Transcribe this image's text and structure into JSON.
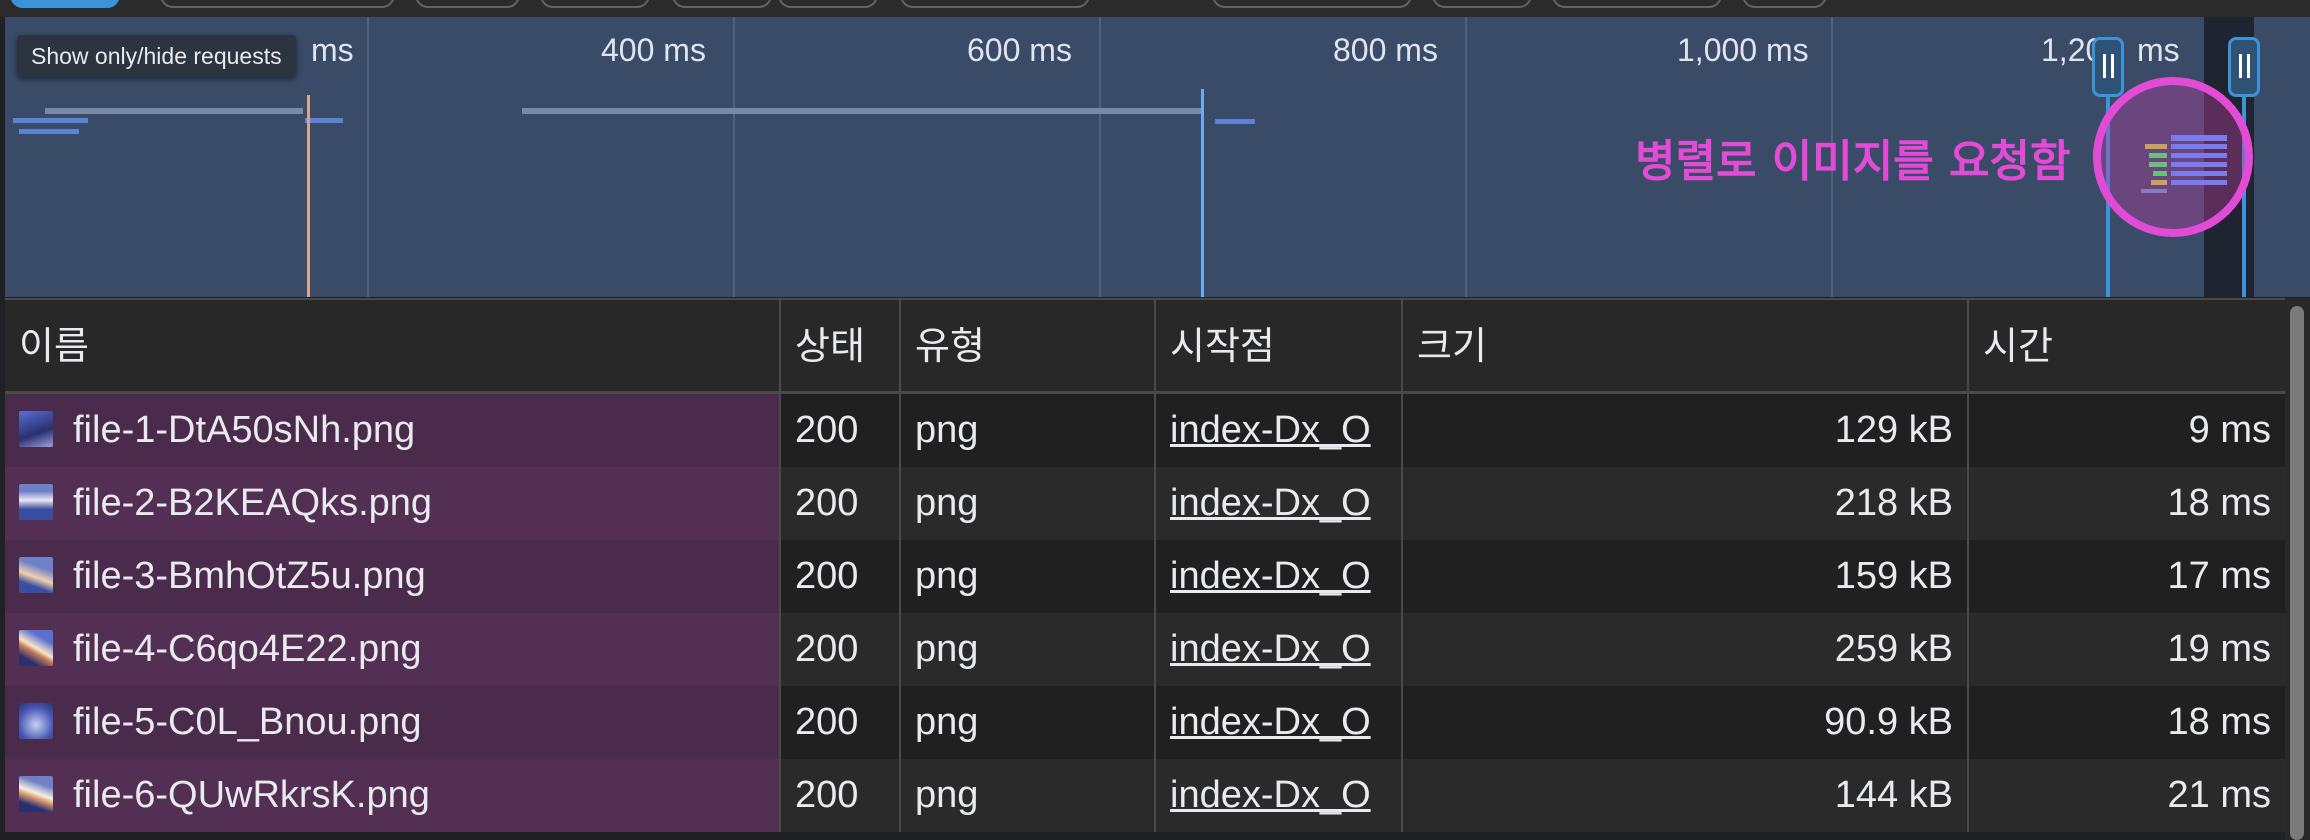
{
  "tooltip": "Show only/hide requests",
  "annotation": "병렬로 이미지를 요청함",
  "overview": {
    "ticks": [
      "ms",
      "400 ms",
      "600 ms",
      "800 ms",
      "1,000 ms",
      "1,20",
      "ms"
    ]
  },
  "columns": [
    "이름",
    "상태",
    "유형",
    "시작점",
    "크기",
    "시간"
  ],
  "rows": [
    {
      "name": "file-1-DtA50sNh.png",
      "status": "200",
      "type": "png",
      "initiator": "index-Dx_O",
      "size": "129 kB",
      "time": "9 ms"
    },
    {
      "name": "file-2-B2KEAQks.png",
      "status": "200",
      "type": "png",
      "initiator": "index-Dx_O",
      "size": "218 kB",
      "time": "18 ms"
    },
    {
      "name": "file-3-BmhOtZ5u.png",
      "status": "200",
      "type": "png",
      "initiator": "index-Dx_O",
      "size": "159 kB",
      "time": "17 ms"
    },
    {
      "name": "file-4-C6qo4E22.png",
      "status": "200",
      "type": "png",
      "initiator": "index-Dx_O",
      "size": "259 kB",
      "time": "19 ms"
    },
    {
      "name": "file-5-C0L_Bnou.png",
      "status": "200",
      "type": "png",
      "initiator": "index-Dx_O",
      "size": "90.9 kB",
      "time": "18 ms"
    },
    {
      "name": "file-6-QUwRkrsK.png",
      "status": "200",
      "type": "png",
      "initiator": "index-Dx_O",
      "size": "144 kB",
      "time": "21 ms"
    }
  ],
  "colors": {
    "annotation": "#e24bd6",
    "accent": "#3d93d8",
    "name_column": "#4a2b4b"
  },
  "icons": [
    "waterfall-icon",
    "image-thumbnail-icon",
    "range-handle-icon"
  ]
}
